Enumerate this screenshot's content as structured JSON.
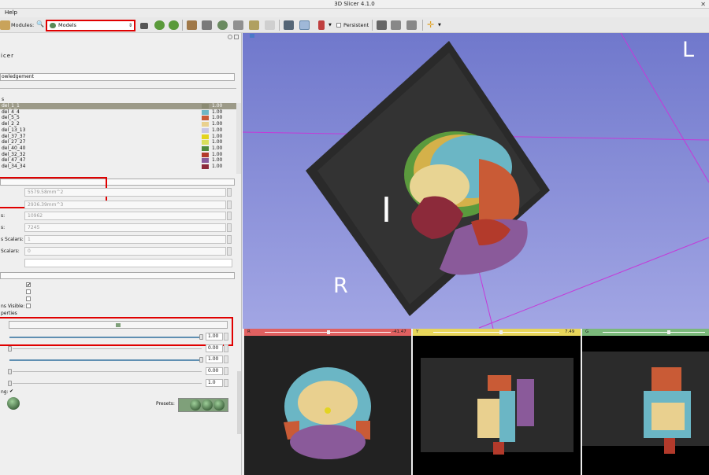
{
  "window_title": "3D Slicer 4.1.0",
  "menu": {
    "help": "Help"
  },
  "toolbar": {
    "modules_label": "Modules:",
    "module_selected": "Models",
    "persistent_label": "Persistent"
  },
  "left": {
    "logo_text": "icer",
    "acknowledgement": "owledgement",
    "hierarchy_header": "s",
    "models": [
      {
        "name": "del_1_1",
        "color": "#8b8b73",
        "opacity": "1.00"
      },
      {
        "name": "del_4_4",
        "color": "#6fb7c4",
        "opacity": "1.00"
      },
      {
        "name": "del_5_5",
        "color": "#c95b36",
        "opacity": "1.00"
      },
      {
        "name": "del_2_2",
        "color": "#e9d08f",
        "opacity": "1.00"
      },
      {
        "name": "del_13_13",
        "color": "#c8c5e6",
        "opacity": "1.00"
      },
      {
        "name": "del_37_37",
        "color": "#e3d421",
        "opacity": "1.00"
      },
      {
        "name": "del_27_27",
        "color": "#d8df5c",
        "opacity": "1.00"
      },
      {
        "name": "del_40_40",
        "color": "#4f8a3c",
        "opacity": "1.00"
      },
      {
        "name": "del_32_32",
        "color": "#b33a2b",
        "opacity": "1.00"
      },
      {
        "name": "del_47_47",
        "color": "#8a5a9a",
        "opacity": "1.00"
      },
      {
        "name": "del_34_34",
        "color": "#8c2a3a",
        "opacity": "1.00"
      }
    ],
    "surface_area": "5579.58mm^2",
    "volume": "2936.39mm^3",
    "points_label": "s:",
    "points_value": "10962",
    "cells_label": "s:",
    "cells_value": "7245",
    "point_scalars_label": "s Scalars:",
    "point_scalars_value": "1",
    "cell_scalars_label": "Scalars:",
    "cell_scalars_value": "0",
    "slice_intersections_label": "ns Visible:",
    "properties_label": "perties",
    "opacity_value": "1.00",
    "slider2_value": "0.00",
    "slider3_value": "1.00",
    "slider4_value": "0.00",
    "slider5_value": "1.0",
    "shading_label": "ng:",
    "presets_label": "Presets:"
  },
  "view3d": {
    "label_L": "L",
    "label_I": "I",
    "label_R": "R"
  },
  "slices": {
    "red_label": "R",
    "red_value": "-41.47",
    "yellow_label": "Y",
    "yellow_value": "7.49",
    "green_label": "G"
  }
}
